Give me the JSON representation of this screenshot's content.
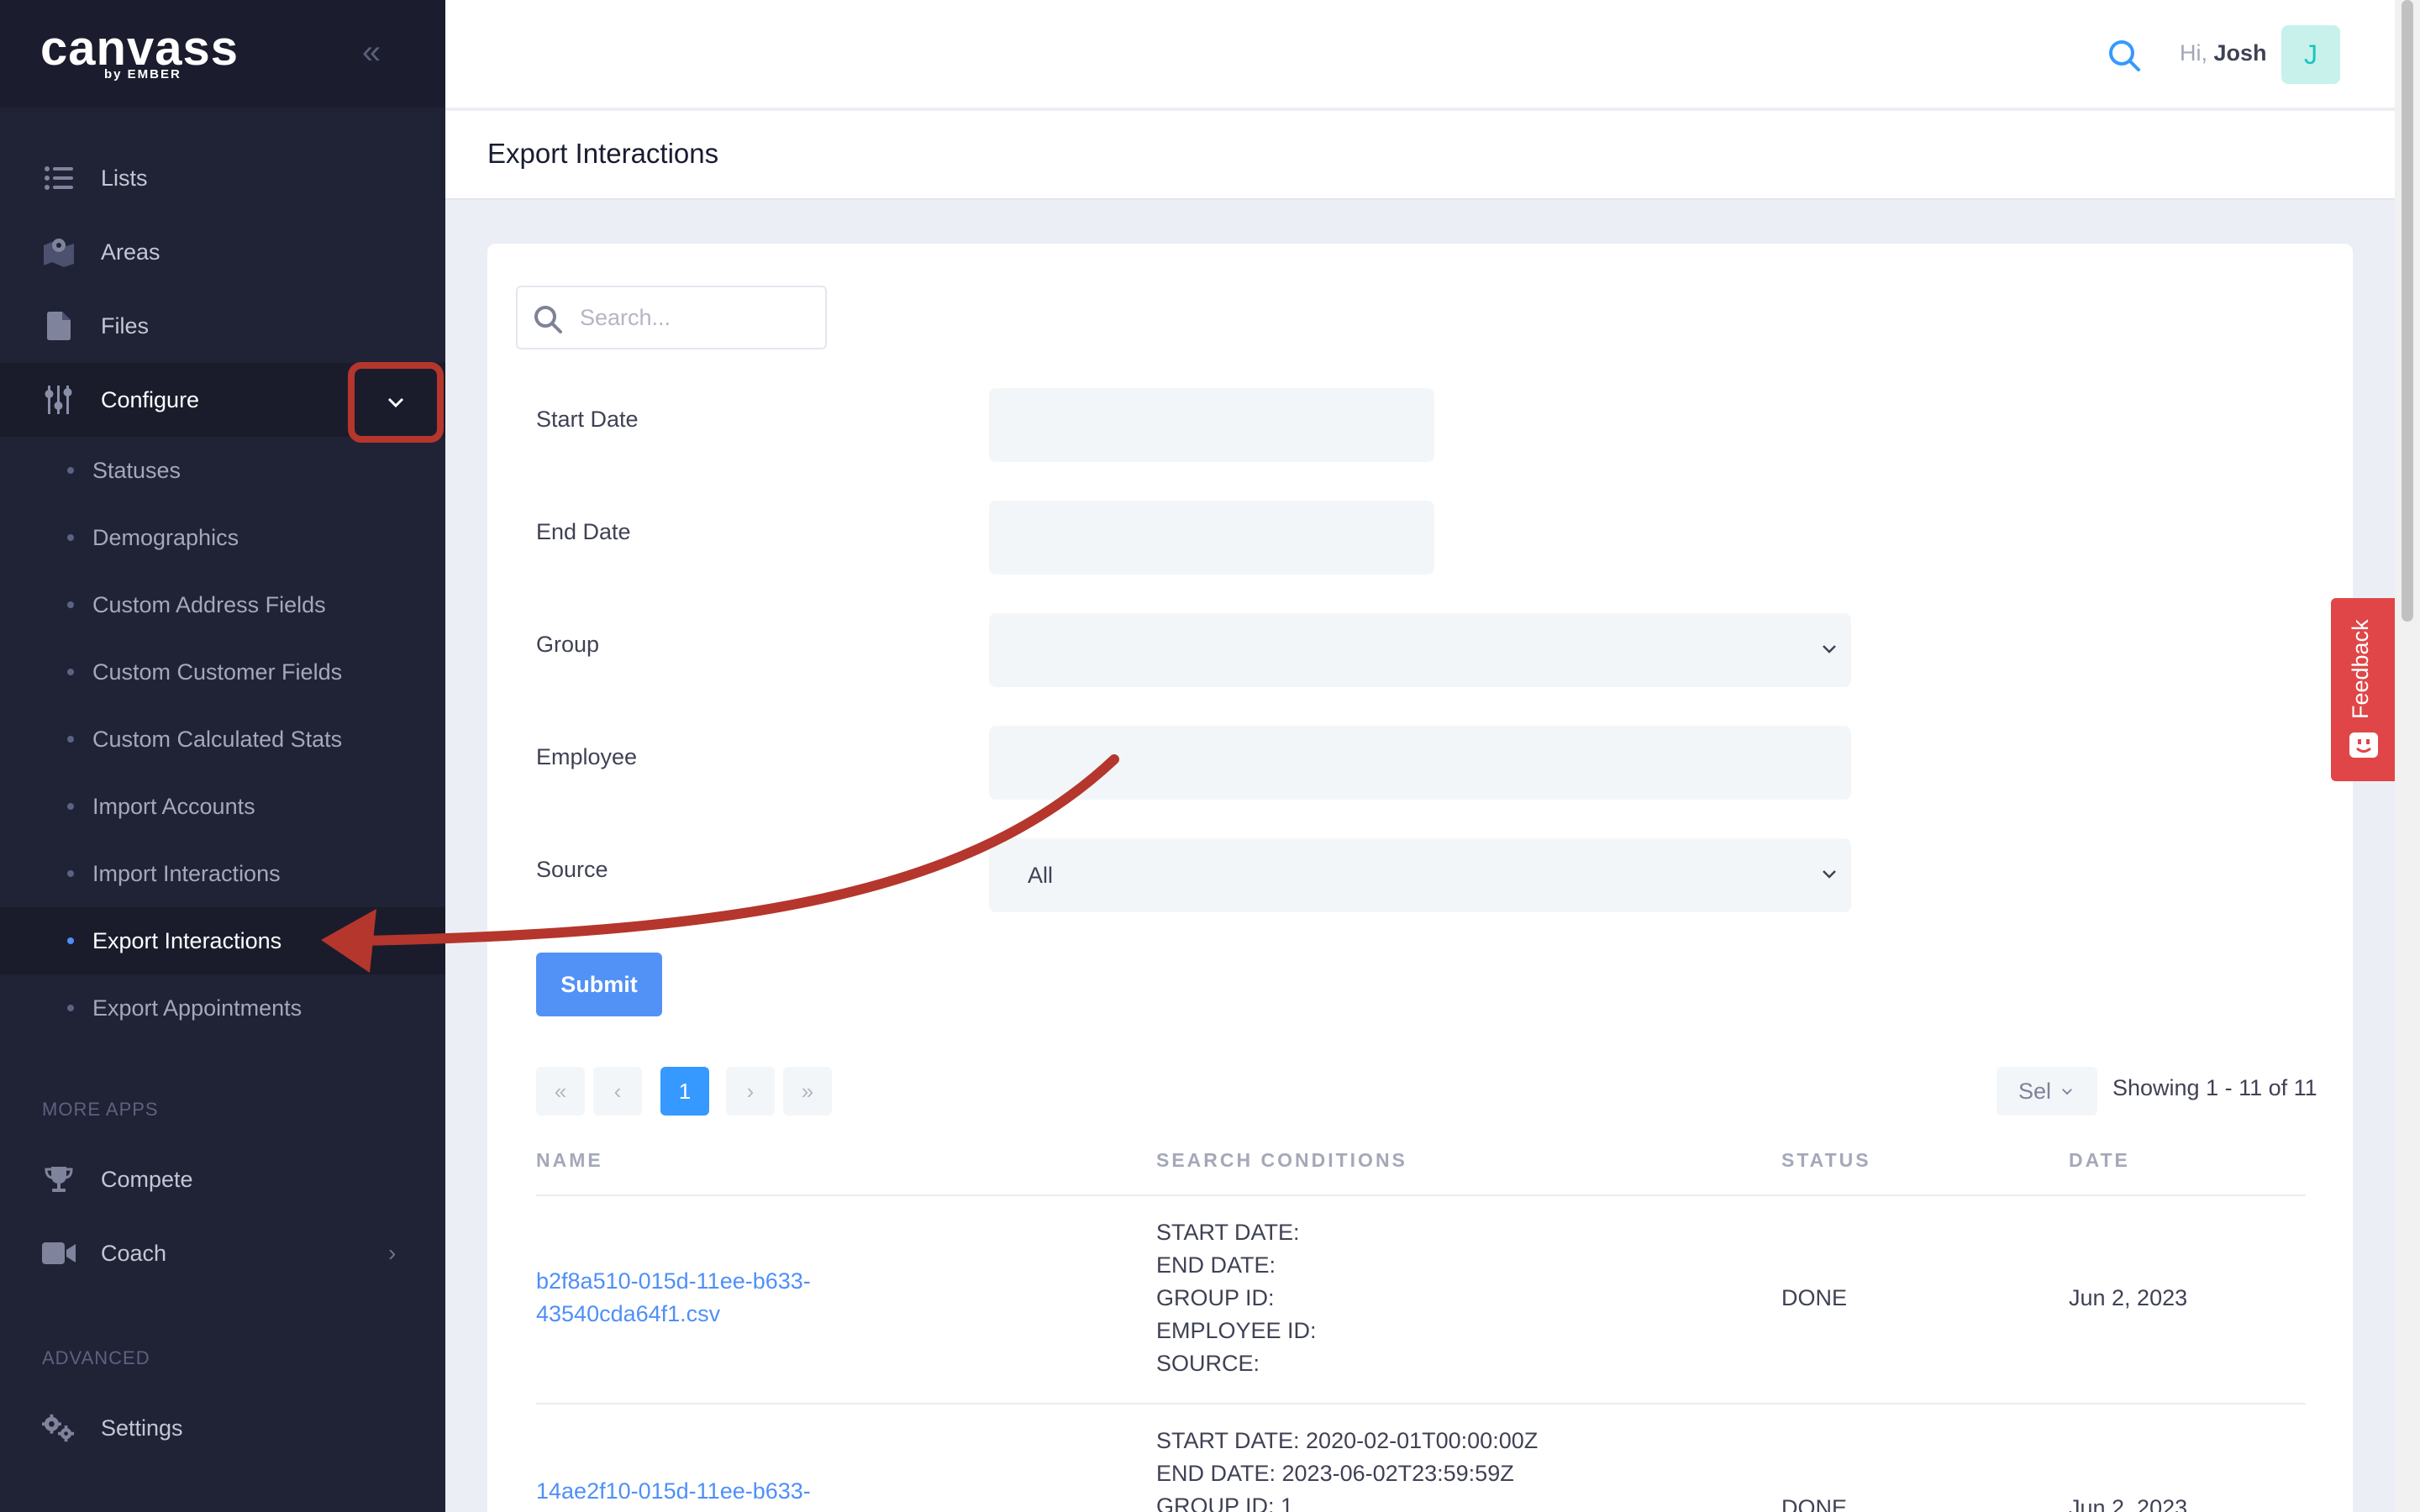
{
  "sidebar": {
    "logo_text": "canvass",
    "logo_sub": "by EMBER",
    "items": [
      {
        "label": "Lists",
        "icon": "list-icon"
      },
      {
        "label": "Areas",
        "icon": "map-icon"
      },
      {
        "label": "Files",
        "icon": "file-icon"
      },
      {
        "label": "Configure",
        "icon": "sliders-icon"
      }
    ],
    "configure_children": [
      "Statuses",
      "Demographics",
      "Custom Address Fields",
      "Custom Customer Fields",
      "Custom Calculated Stats",
      "Import Accounts",
      "Import Interactions",
      "Export Interactions",
      "Export Appointments"
    ],
    "more_apps_title": "MORE APPS",
    "more_apps": [
      {
        "label": "Compete",
        "icon": "trophy-icon"
      },
      {
        "label": "Coach",
        "icon": "video-icon"
      }
    ],
    "advanced_title": "ADVANCED",
    "advanced": [
      {
        "label": "Settings",
        "icon": "gears-icon"
      }
    ]
  },
  "topbar": {
    "greeting": "Hi,",
    "user_name": "Josh",
    "avatar_letter": "J"
  },
  "page": {
    "title": "Export Interactions"
  },
  "form": {
    "search_placeholder": "Search...",
    "start_date_label": "Start Date",
    "end_date_label": "End Date",
    "group_label": "Group",
    "employee_label": "Employee",
    "source_label": "Source",
    "source_value": "All",
    "submit_label": "Submit"
  },
  "pagination": {
    "first": "«",
    "prev": "‹",
    "current": "1",
    "next": "›",
    "last": "»",
    "per_page_value": "Sel",
    "showing": "Showing 1 - 11 of 11"
  },
  "table": {
    "headers": [
      "NAME",
      "SEARCH CONDITIONS",
      "STATUS",
      "DATE"
    ],
    "rows": [
      {
        "name_line1": "b2f8a510-015d-11ee-b633-",
        "name_line2": "43540cda64f1.csv",
        "conditions": [
          "START DATE:",
          "END DATE:",
          "GROUP ID:",
          "EMPLOYEE ID:",
          "SOURCE:"
        ],
        "status": "DONE",
        "date": "Jun 2, 2023"
      },
      {
        "name_line1": "14ae2f10-015d-11ee-b633-",
        "conditions": [
          "START DATE: 2020-02-01T00:00:00Z",
          "END DATE: 2023-06-02T23:59:59Z",
          "GROUP ID: 1"
        ],
        "status": "DONE",
        "date": "Jun 2, 2023"
      }
    ]
  },
  "feedback": {
    "label": "Feedback",
    "color": "#e04647"
  },
  "colors": {
    "sidebar_bg": "#202236",
    "accent": "#4f8ff7",
    "annotation": "#b5362c"
  }
}
